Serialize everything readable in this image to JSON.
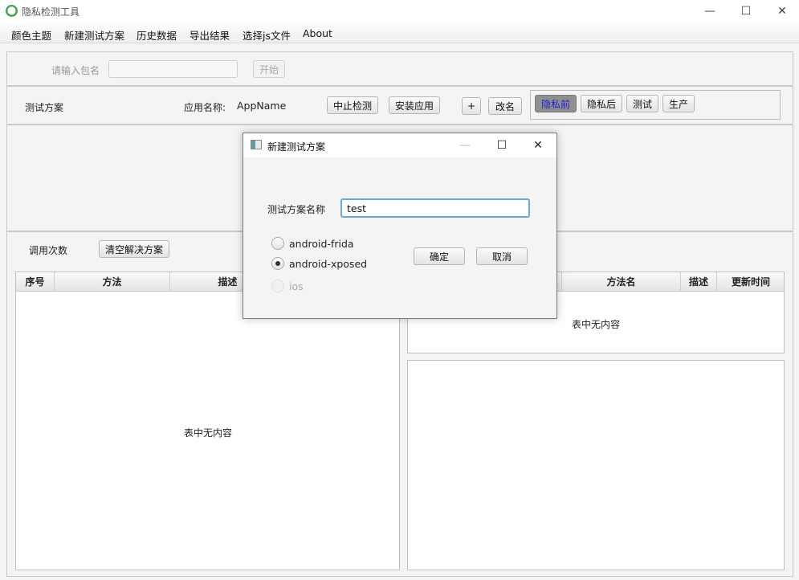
{
  "window": {
    "title": "隐私检测工具",
    "minimize": "—",
    "maximize": "☐",
    "close": "✕"
  },
  "menu": [
    "颜色主题",
    "新建测试方案",
    "历史数据",
    "导出结果",
    "选择js文件",
    "About"
  ],
  "top_panel": {
    "package_label": "请输入包名",
    "package_value": "",
    "start_button": "开始"
  },
  "scheme_panel": {
    "scheme_label": "测试方案",
    "app_name_label": "应用名称:",
    "app_name_value": "AppName",
    "stop_button": "中止检测",
    "install_button": "安装应用",
    "add_button": "+",
    "rename_button": "改名",
    "toggles": [
      "隐私前",
      "隐私后",
      "测试",
      "生产"
    ],
    "selected_toggle": "隐私前"
  },
  "calls_panel": {
    "count_label": "调用次数",
    "clear_button": "清空解决方案"
  },
  "left_table": {
    "columns": [
      "序号",
      "方法",
      "描述"
    ],
    "empty_text": "表中无内容"
  },
  "right_table": {
    "columns": [
      "方法名",
      "描述",
      "更新时间"
    ],
    "empty_text": "表中无内容"
  },
  "dialog": {
    "title": "新建测试方案",
    "minimize": "—",
    "maximize": "☐",
    "close": "✕",
    "name_label": "测试方案名称",
    "name_value": "test",
    "options": [
      "android-frida",
      "android-xposed",
      "ios"
    ],
    "selected_option": "android-xposed",
    "ok_button": "确定",
    "cancel_button": "取消"
  }
}
